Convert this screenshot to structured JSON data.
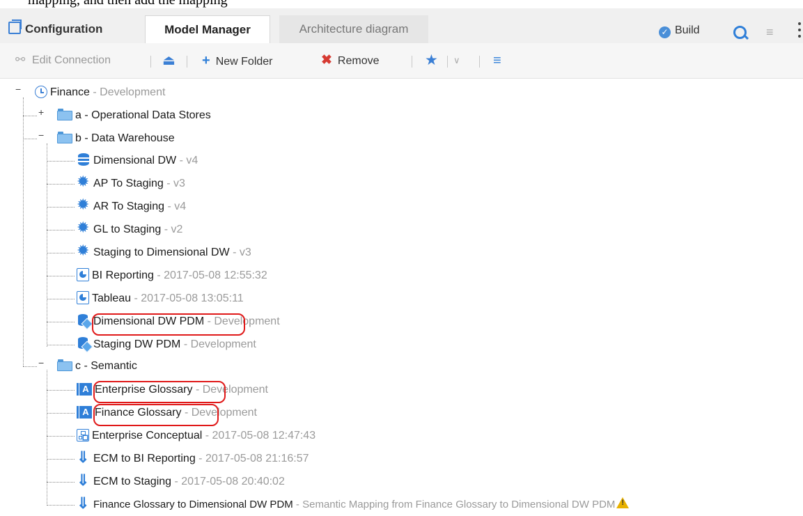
{
  "caption_fragment": "mapping, and then add the mapping",
  "tabs": {
    "configuration": "Configuration",
    "model_manager": "Model Manager",
    "architecture_diagram": "Architecture diagram"
  },
  "header_actions": {
    "build": "Build"
  },
  "toolbar": {
    "edit_connection": "Edit Connection",
    "new_folder": "New Folder",
    "remove": "Remove"
  },
  "tree": {
    "root": {
      "name": "Finance",
      "suffix": "- Development"
    },
    "folder_a": {
      "name": "a - Operational Data Stores",
      "suffix": ""
    },
    "folder_b": {
      "name": "b - Data Warehouse",
      "suffix": ""
    },
    "folder_b_items": [
      {
        "name": "Dimensional DW",
        "suffix": " - v4",
        "icon": "database-icon"
      },
      {
        "name": "AP To Staging",
        "suffix": " - v3",
        "icon": "gear-icon"
      },
      {
        "name": "AR To Staging",
        "suffix": " - v4",
        "icon": "gear-icon"
      },
      {
        "name": "GL to Staging",
        "suffix": " - v2",
        "icon": "gear-icon"
      },
      {
        "name": "Staging to Dimensional DW",
        "suffix": " - v3",
        "icon": "gear-icon"
      },
      {
        "name": "BI Reporting",
        "suffix": " - 2017-05-08 12:55:32",
        "icon": "report-icon"
      },
      {
        "name": "Tableau",
        "suffix": " - 2017-05-08 13:05:11",
        "icon": "report-icon"
      },
      {
        "name": "Dimensional DW PDM",
        "suffix": " - Development",
        "icon": "pdm-icon"
      },
      {
        "name": "Staging DW PDM",
        "suffix": " - Development",
        "icon": "pdm-icon"
      }
    ],
    "folder_c": {
      "name": "c - Semantic",
      "suffix": ""
    },
    "folder_c_items": [
      {
        "name": "Enterprise Glossary",
        "suffix": " - Development",
        "icon": "glossary-icon"
      },
      {
        "name": "Finance Glossary",
        "suffix": " - Development",
        "icon": "glossary-icon"
      },
      {
        "name": "Enterprise Conceptual",
        "suffix": " - 2017-05-08 12:47:43",
        "icon": "conceptual-model-icon"
      },
      {
        "name": "ECM to BI Reporting",
        "suffix": " - 2017-05-08 21:16:57",
        "icon": "mapping-icon"
      },
      {
        "name": "ECM to Staging",
        "suffix": " - 2017-05-08 20:40:02",
        "icon": "mapping-icon"
      },
      {
        "name": "Finance Glossary to Dimensional DW PDM",
        "suffix": " - Semantic Mapping from Finance Glossary to Dimensional DW PDM",
        "icon": "mapping-icon"
      }
    ]
  },
  "colors": {
    "accent": "#2f7fd8",
    "highlight_box": "#e01818",
    "muted_text": "#9a9a9a",
    "warning": "#e8b100"
  }
}
